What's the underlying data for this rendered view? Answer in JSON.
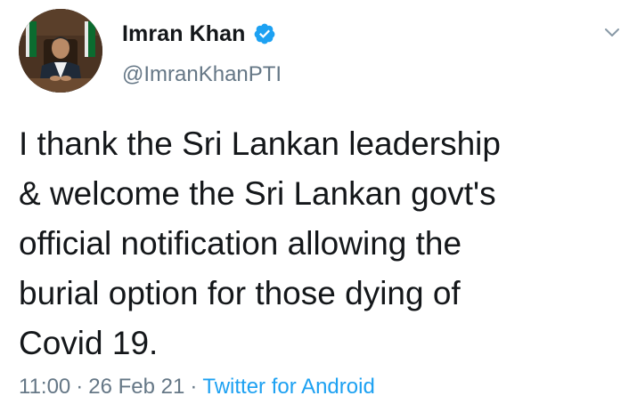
{
  "author": {
    "display_name": "Imran Khan",
    "handle": "@ImranKhanPTI",
    "verified": true,
    "avatar_icon": "profile-photo"
  },
  "tweet": {
    "text": "I thank the Sri Lankan leadership\n& welcome the Sri Lankan govt's\nofficial notification allowing the\nburial option for those dying of\nCovid 19.",
    "time": "11:00",
    "date": "26 Feb 21",
    "separator": "·",
    "source": "Twitter for Android"
  },
  "colors": {
    "verified_blue": "#1da1f2",
    "secondary_text": "#657786",
    "link": "#1da1f2"
  },
  "menu": {
    "icon": "chevron-down-icon"
  }
}
